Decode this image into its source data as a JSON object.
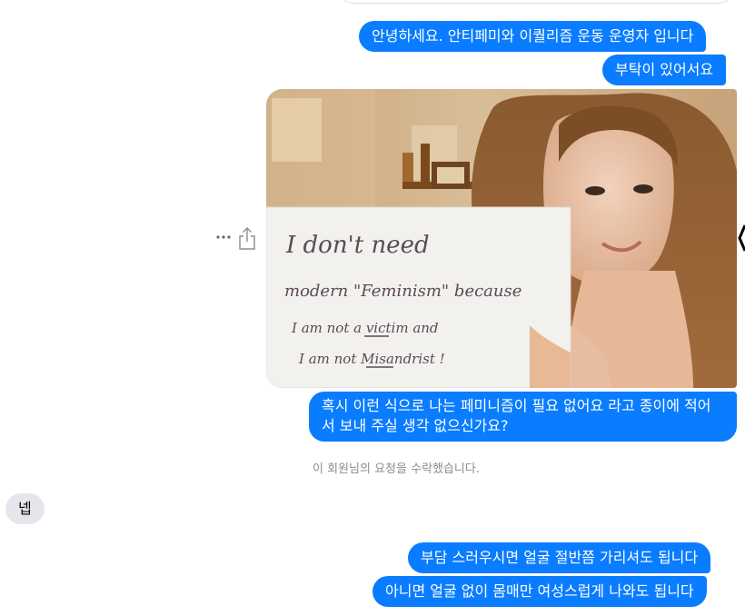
{
  "messages": {
    "sent_1": "안녕하세요. 안티페미와 이퀄리즘 운동 운영자 입니다",
    "sent_2": "부탁이 있어서요",
    "photo_sign": {
      "line1": "I  don't  need",
      "line2": "modern \"Feminism\" because",
      "line3": "I  am  not  a victim  and",
      "line4": "I  am  not  Misandrist !"
    },
    "sent_3": "혹시 이런 식으로 나는 페미니즘이 필요 없어요 라고 종이에 적어서 보내 주실 생각 없으신가요?",
    "status_text": "이 회원님의 요청을 수락했습니다.",
    "received_1": "넵",
    "sent_4": "부담 스러우시면 얼굴 절반쯤 가리셔도 됩니다",
    "sent_5": "아니면 얼굴 없이 몸매만 여성스럽게 나와도 됩니다"
  },
  "icons": {
    "more": "more-horizontal-icon",
    "share": "share-icon"
  },
  "colors": {
    "sent_bubble": "#0a7cff",
    "received_bubble": "#e4e6eb",
    "status_text": "#8a8d91"
  }
}
